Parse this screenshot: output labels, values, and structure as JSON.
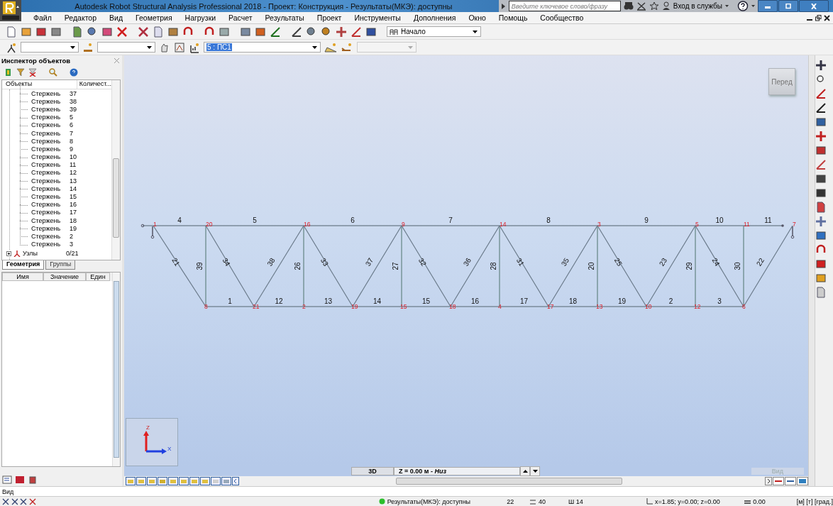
{
  "window": {
    "title": "Autodesk Robot Structural Analysis Professional 2018 - Проект: Конструкция - Результаты(МКЭ): доступны"
  },
  "search": {
    "placeholder": "Введите ключевое слово/фразу"
  },
  "sign_in": "Вход в службы",
  "menu": [
    "Файл",
    "Редактор",
    "Вид",
    "Геометрия",
    "Нагрузки",
    "Расчет",
    "Результаты",
    "Проект",
    "Инструменты",
    "Дополнения",
    "Окно",
    "Помощь",
    "Сообщество"
  ],
  "toolbar": {
    "start_view": "Начало",
    "load_case": "5 : ПС1"
  },
  "inspector": {
    "title": "Инспектор объектов",
    "columns": [
      "Объекты",
      "Количест..."
    ],
    "items": [
      {
        "children": [
          {
            "label": "Стержень",
            "value": "37"
          },
          {
            "label": "Стержень",
            "value": "38"
          },
          {
            "label": "Стержень",
            "value": "39"
          },
          {
            "label": "Стержень",
            "value": "5"
          },
          {
            "label": "Стержень",
            "value": "6"
          },
          {
            "label": "Стержень",
            "value": "7"
          },
          {
            "label": "Стержень",
            "value": "8"
          },
          {
            "label": "Стержень",
            "value": "9"
          },
          {
            "label": "Стержень",
            "value": "10"
          },
          {
            "label": "Стержень",
            "value": "11"
          },
          {
            "label": "Стержень",
            "value": "12"
          },
          {
            "label": "Стержень",
            "value": "13"
          },
          {
            "label": "Стержень",
            "value": "14"
          },
          {
            "label": "Стержень",
            "value": "15"
          },
          {
            "label": "Стержень",
            "value": "16"
          },
          {
            "label": "Стержень",
            "value": "17"
          },
          {
            "label": "Стержень",
            "value": "18"
          },
          {
            "label": "Стержень",
            "value": "19"
          },
          {
            "label": "Стержень",
            "value": "2"
          },
          {
            "label": "Стержень",
            "value": "3"
          }
        ]
      },
      {
        "label": "Узлы",
        "value": "0/21",
        "expanded": false
      }
    ],
    "tabs": [
      {
        "label": "Геометрия",
        "selected": true
      },
      {
        "label": "Группы",
        "selected": false
      }
    ],
    "property_columns": [
      "Имя",
      "Значение",
      "Един"
    ]
  },
  "view": {
    "cube_face": "Перед",
    "axes": [
      "Z",
      "X"
    ],
    "model": {
      "top_nodes": [
        "1",
        "20",
        "16",
        "9",
        "14",
        "3",
        "5",
        "11",
        "7"
      ],
      "bottom_nodes": [
        "8",
        "21",
        "2",
        "19",
        "15",
        "18",
        "4",
        "17",
        "13",
        "10",
        "12",
        "6"
      ],
      "top_bars": [
        "4",
        "5",
        "6",
        "7",
        "8",
        "9",
        "10",
        "11"
      ],
      "bottom_bars": [
        "1",
        "12",
        "13",
        "14",
        "15",
        "16",
        "17",
        "18",
        "19",
        "2",
        "3"
      ],
      "verticals": [
        "39",
        "26",
        "27",
        "28",
        "20",
        "29",
        "30"
      ],
      "diagonals": [
        "21",
        "34",
        "38",
        "33",
        "37",
        "32",
        "36",
        "31",
        "35",
        "25",
        "23",
        "24",
        "22"
      ]
    },
    "mode": "3D",
    "plane": "Z = 0.00 м - *Низ*",
    "view_button": {
      "label": "Вид",
      "disabled": true
    }
  },
  "command_line": "Вид",
  "status_bar": {
    "state": "Результаты(МКЭ): доступны",
    "nodes": "22",
    "bars": "40",
    "section": "Ш 14",
    "coords": "x=1.85; y=0.00; z=0.00",
    "angle": "0.00",
    "units": "[м] [т] [град.]"
  }
}
